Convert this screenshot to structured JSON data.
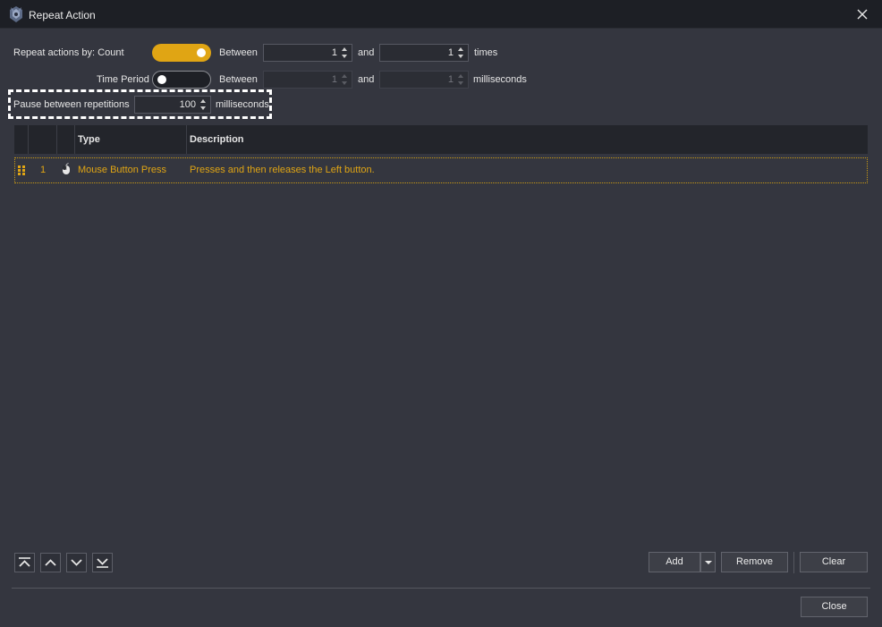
{
  "window": {
    "title": "Repeat Action",
    "close_icon": "close-icon"
  },
  "repeat": {
    "label_by": "Repeat actions by: Count",
    "label_time_period": "Time Period",
    "count_toggle_on": true,
    "time_toggle_on": false,
    "count_row": {
      "between_label": "Between",
      "from": "1",
      "and_label": "and",
      "to": "1",
      "unit": "times"
    },
    "time_row": {
      "between_label": "Between",
      "from": "1",
      "and_label": "and",
      "to": "1",
      "unit": "milliseconds"
    }
  },
  "pause": {
    "label": "Pause between repetitions",
    "value": "100",
    "unit": "milliseconds"
  },
  "table": {
    "headers": [
      "",
      "",
      "",
      "Type",
      "Description"
    ],
    "rows": [
      {
        "index": "1",
        "icon": "mouse-icon",
        "type": "Mouse Button Press",
        "description": "Presses and then releases the Left button."
      }
    ]
  },
  "buttons": {
    "add": "Add",
    "remove": "Remove",
    "clear": "Clear",
    "close": "Close"
  },
  "move_buttons": [
    "move-to-top-icon",
    "move-up-icon",
    "move-down-icon",
    "move-to-bottom-icon"
  ],
  "colors": {
    "accent": "#e0a514",
    "background": "#34363f",
    "titlebar": "#1d1f25"
  }
}
